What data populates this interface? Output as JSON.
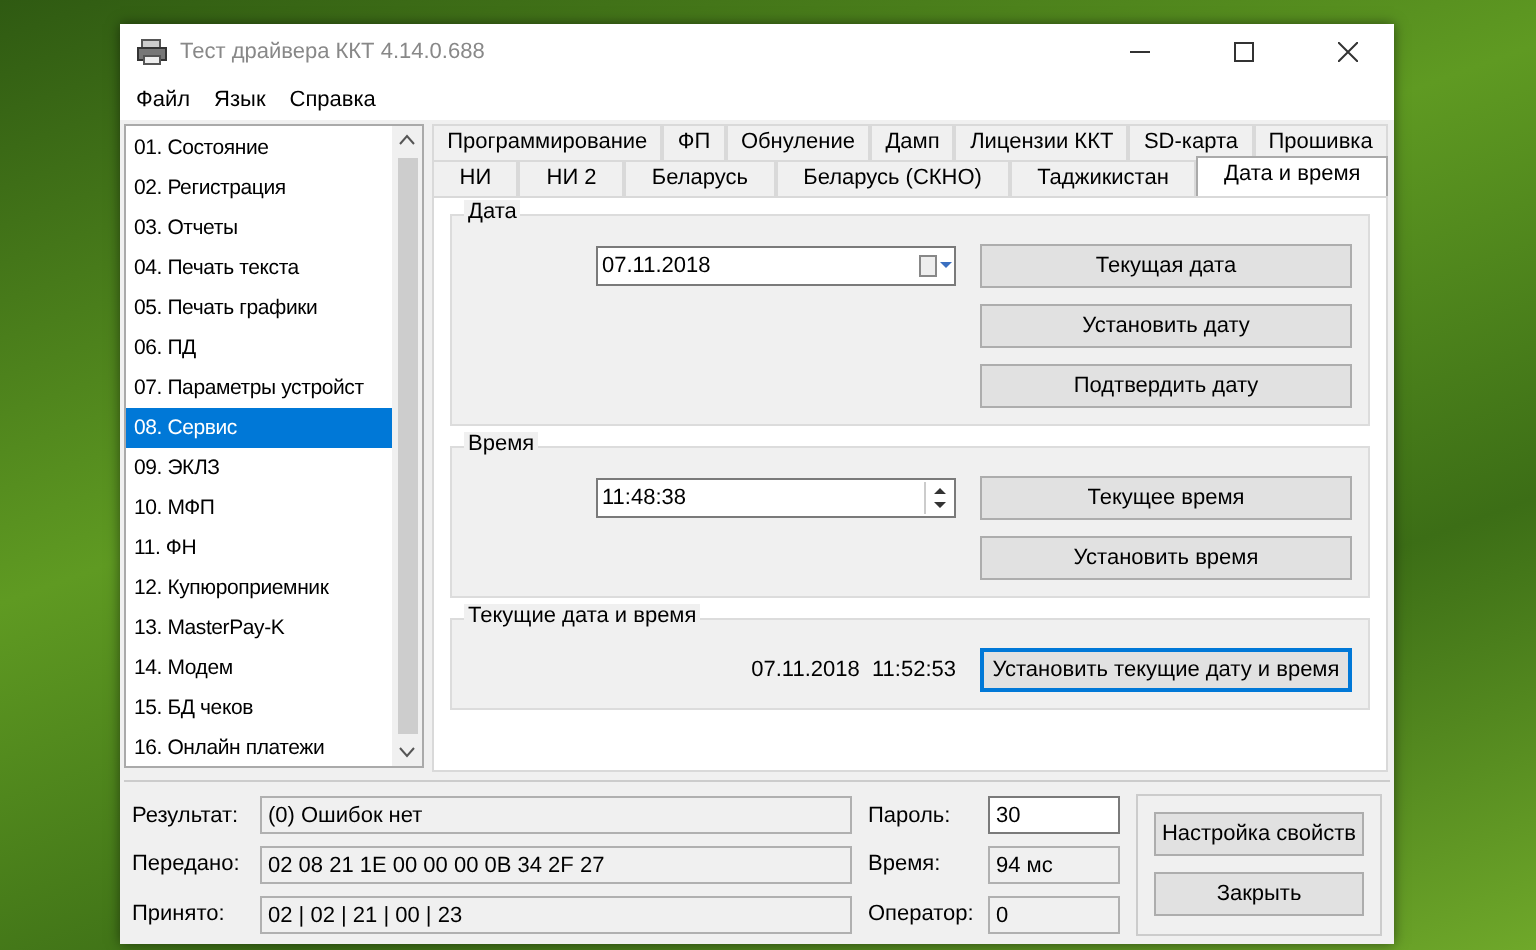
{
  "window": {
    "title": "Тест драйвера ККТ 4.14.0.688"
  },
  "menu": [
    "Файл",
    "Язык",
    "Справка"
  ],
  "sidebar": {
    "items": [
      {
        "label": "01. Состояние",
        "selected": false
      },
      {
        "label": "02. Регистрация",
        "selected": false
      },
      {
        "label": "03. Отчеты",
        "selected": false
      },
      {
        "label": "04. Печать текста",
        "selected": false
      },
      {
        "label": "05. Печать графики",
        "selected": false
      },
      {
        "label": "06. ПД",
        "selected": false
      },
      {
        "label": "07. Параметры устройст",
        "selected": false
      },
      {
        "label": "08. Сервис",
        "selected": true
      },
      {
        "label": "09. ЭКЛЗ",
        "selected": false
      },
      {
        "label": "10. МФП",
        "selected": false
      },
      {
        "label": "11. ФН",
        "selected": false
      },
      {
        "label": "12. Купюроприемник",
        "selected": false
      },
      {
        "label": "13. MasterPay-K",
        "selected": false
      },
      {
        "label": "14. Модем",
        "selected": false
      },
      {
        "label": "15. БД чеков",
        "selected": false
      },
      {
        "label": "16. Онлайн платежи",
        "selected": false
      }
    ]
  },
  "tabs": {
    "rows": [
      {
        "items": [
          {
            "label": "Программирование",
            "selected": false
          },
          {
            "label": "ФП",
            "selected": false
          },
          {
            "label": "Обнуление",
            "selected": false
          },
          {
            "label": "Дамп",
            "selected": false
          },
          {
            "label": "Лицензии ККТ",
            "selected": false
          },
          {
            "label": "SD-карта",
            "selected": false
          },
          {
            "label": "Прошивка",
            "selected": false
          }
        ]
      },
      {
        "items": [
          {
            "label": "НИ",
            "selected": false
          },
          {
            "label": "НИ 2",
            "selected": false
          },
          {
            "label": "Беларусь",
            "selected": false
          },
          {
            "label": "Беларусь (СКНО)",
            "selected": false
          },
          {
            "label": "Таджикистан",
            "selected": false
          },
          {
            "label": "Дата и время",
            "selected": true
          }
        ]
      }
    ]
  },
  "groups": [
    {
      "title": "Дата",
      "kind": "date",
      "value": "07.11.2018",
      "buttons": [
        {
          "label": "Текущая дата",
          "focused": false
        },
        {
          "label": "Установить дату",
          "focused": false
        },
        {
          "label": "Подтвердить дату",
          "focused": false
        }
      ]
    },
    {
      "title": "Время",
      "kind": "time",
      "value": "11:48:38",
      "buttons": [
        {
          "label": "Текущее время",
          "focused": false
        },
        {
          "label": "Установить время",
          "focused": false
        }
      ]
    },
    {
      "title": "Текущие дата и время",
      "kind": "readout",
      "value": "07.11.2018  11:52:53",
      "buttons": [
        {
          "label": "Установить текущие дату и время",
          "focused": true
        }
      ]
    }
  ],
  "status": {
    "left": [
      {
        "label": "Результат:",
        "value": "(0) Ошибок нет",
        "editable": false
      },
      {
        "label": "Передано:",
        "value": "02 08 21 1E 00 00 00 0B 34 2F 27",
        "editable": false
      },
      {
        "label": "Принято:",
        "value": "02 | 02 | 21 | 00 | 23",
        "editable": false
      }
    ],
    "right": [
      {
        "label": "Пароль:",
        "value": "30",
        "editable": true
      },
      {
        "label": "Время:",
        "value": "94 мс",
        "editable": false
      },
      {
        "label": "Оператор:",
        "value": "0",
        "editable": false
      }
    ],
    "buttons": [
      "Настройка свойств",
      "Закрыть"
    ]
  }
}
